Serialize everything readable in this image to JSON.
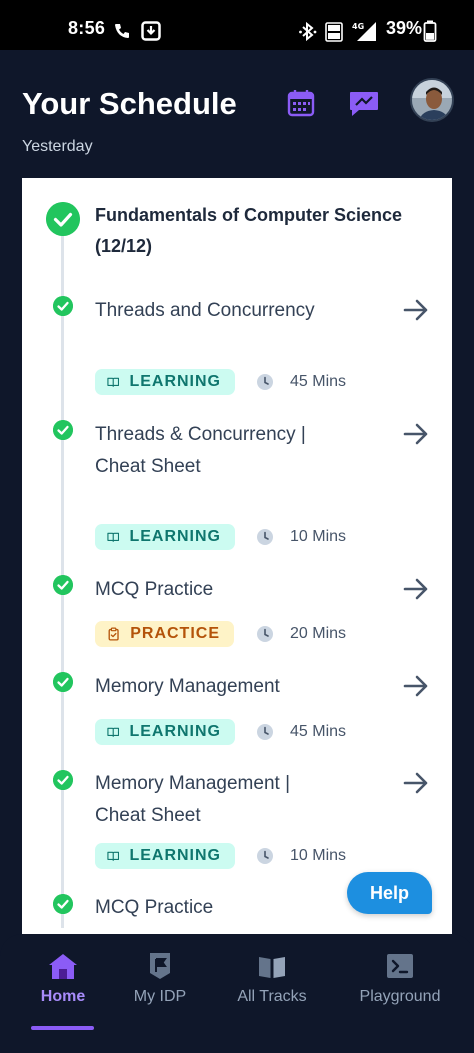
{
  "status_bar": {
    "time": "8:56",
    "battery": "39%"
  },
  "header": {
    "title": "Your Schedule",
    "subtitle": "Yesterday"
  },
  "course": {
    "title": "Fundamentals of Computer Science (12/12)"
  },
  "items": [
    {
      "title": "Threads and Concurrency",
      "type": "LEARNING",
      "duration": "45 Mins"
    },
    {
      "title": "Threads & Concurrency | Cheat Sheet",
      "type": "LEARNING",
      "duration": "10 Mins"
    },
    {
      "title": "MCQ Practice",
      "type": "PRACTICE",
      "duration": "20 Mins"
    },
    {
      "title": "Memory Management",
      "type": "LEARNING",
      "duration": "45 Mins"
    },
    {
      "title": "Memory Management | Cheat Sheet",
      "type": "LEARNING",
      "duration": "10 Mins"
    },
    {
      "title": "MCQ Practice"
    }
  ],
  "help_label": "Help",
  "nav": [
    {
      "label": "Home",
      "icon": "home-icon",
      "active": true
    },
    {
      "label": "My IDP",
      "icon": "flag-icon",
      "active": false
    },
    {
      "label": "All Tracks",
      "icon": "book-icon",
      "active": false
    },
    {
      "label": "Playground",
      "icon": "terminal-icon",
      "active": false
    }
  ],
  "colors": {
    "accent": "#8b5cf6",
    "success": "#22c55e",
    "help": "#1d8fe0"
  }
}
